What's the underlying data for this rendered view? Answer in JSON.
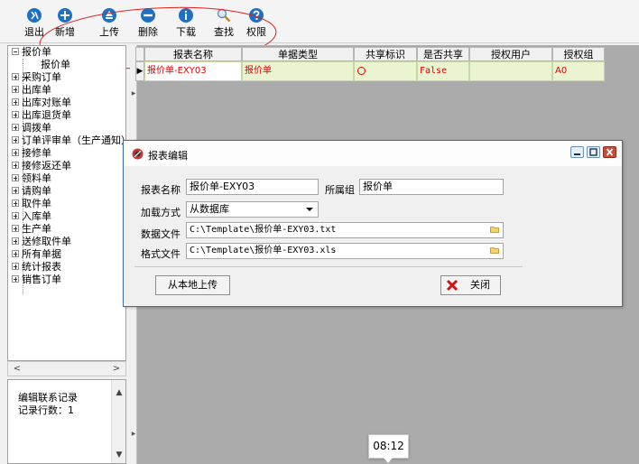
{
  "toolbar": {
    "exit": "退出",
    "add": "新增",
    "upload": "上传",
    "delete": "删除",
    "download": "下载",
    "search": "查找",
    "permission": "权限"
  },
  "tree": {
    "root": "报价单",
    "root_child": "报价单",
    "items": [
      "采购订单",
      "出库单",
      "出库对账单",
      "出库退货单",
      "调拨单",
      "订单评审单（生产通知）",
      "接修单",
      "接修返还单",
      "领料单",
      "请购单",
      "取件单",
      "入库单",
      "生产单",
      "送修取件单",
      "所有单据",
      "统计报表",
      "销售订单"
    ]
  },
  "info": {
    "line1": "编辑联系记录",
    "line2": "记录行数：1"
  },
  "grid": {
    "headers": [
      "报表名称",
      "单据类型",
      "共享标识",
      "是否共享",
      "授权用户",
      "授权组"
    ],
    "row": {
      "name": "报价单-EXY03",
      "type": "报价单",
      "share_flag": "",
      "is_shared": "False",
      "user": "",
      "group": "A0"
    }
  },
  "dialog": {
    "title": "报表编辑",
    "report_name_label": "报表名称",
    "report_name": "报价单-EXY03",
    "group_label": "所属组",
    "group": "报价单",
    "load_label": "加载方式",
    "load_value": "从数据库",
    "data_file_label": "数据文件",
    "data_file": "C:\\Template\\报价单-EXY03.txt",
    "format_file_label": "格式文件",
    "format_file": "C:\\Template\\报价单-EXY03.xls",
    "upload_button": "从本地上传",
    "close_button": "关闭"
  },
  "tooltip": "08:12",
  "colors": {
    "annotation": "#e02020",
    "grid_cell_bg": "#eaf4d0",
    "grid_text": "#e00000",
    "toolbar_icon": "#1f6fc2"
  }
}
